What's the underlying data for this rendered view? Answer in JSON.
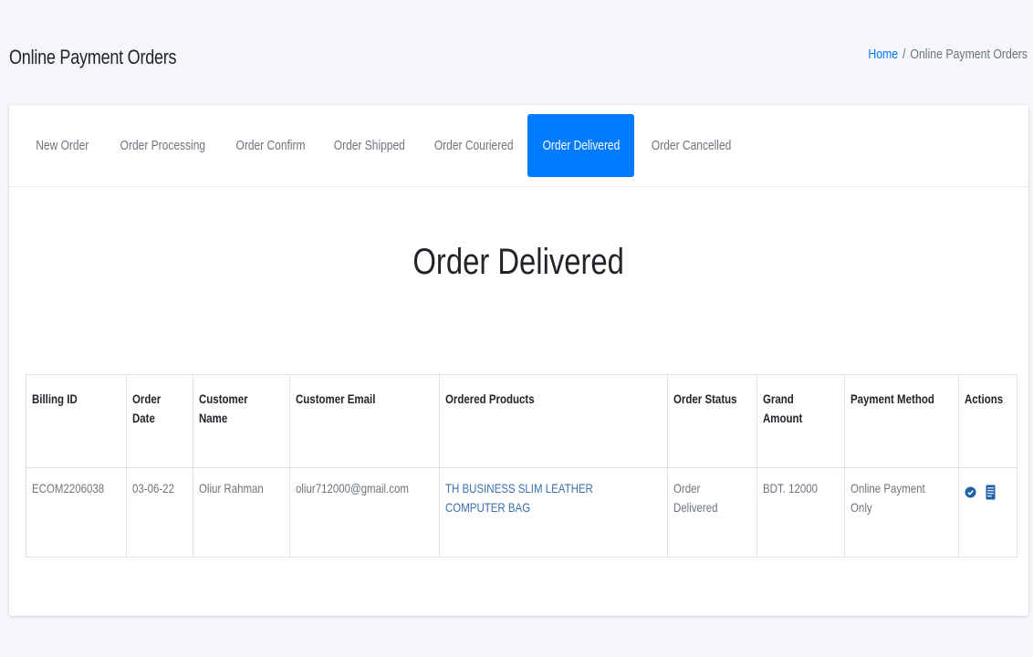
{
  "header": {
    "title": "Online Payment Orders",
    "breadcrumb": {
      "home": "Home",
      "separator": "/",
      "current": "Online Payment Orders"
    }
  },
  "tabs": [
    {
      "label": "New Order",
      "active": false
    },
    {
      "label": "Order Processing",
      "active": false
    },
    {
      "label": "Order Confirm",
      "active": false
    },
    {
      "label": "Order Shipped",
      "active": false
    },
    {
      "label": "Order Couriered",
      "active": false
    },
    {
      "label": "Order Delivered",
      "active": true
    },
    {
      "label": "Order Cancelled",
      "active": false
    }
  ],
  "section_title": "Order Delivered",
  "table": {
    "headers": {
      "billing_id": "Billing ID",
      "order_date_1": "Order",
      "order_date_2": "Date",
      "customer_name_1": "Customer",
      "customer_name_2": "Name",
      "customer_email": "Customer Email",
      "ordered_products": "Ordered Products",
      "order_status": "Order Status",
      "grand_amount_1": "Grand",
      "grand_amount_2": "Amount",
      "payment_method": "Payment Method",
      "actions": "Actions"
    },
    "rows": [
      {
        "billing_id": "ECOM2206038",
        "order_date": "03-06-22",
        "customer_name": "Oliur Rahman",
        "customer_email": "oliur712000@gmail.com",
        "product_line1": "TH BUSINESS SLIM LEATHER",
        "product_line2": "COMPUTER BAG",
        "status_line1": "Order",
        "status_line2": "Delivered",
        "grand_amount": "BDT. 12000",
        "payment_line1": "Online Payment",
        "payment_line2": "Only",
        "actions": [
          "view-icon",
          "invoice-icon"
        ]
      }
    ]
  },
  "colors": {
    "accent": "#007bff",
    "link": "#3a6fb0",
    "background": "#f4f6f9"
  }
}
